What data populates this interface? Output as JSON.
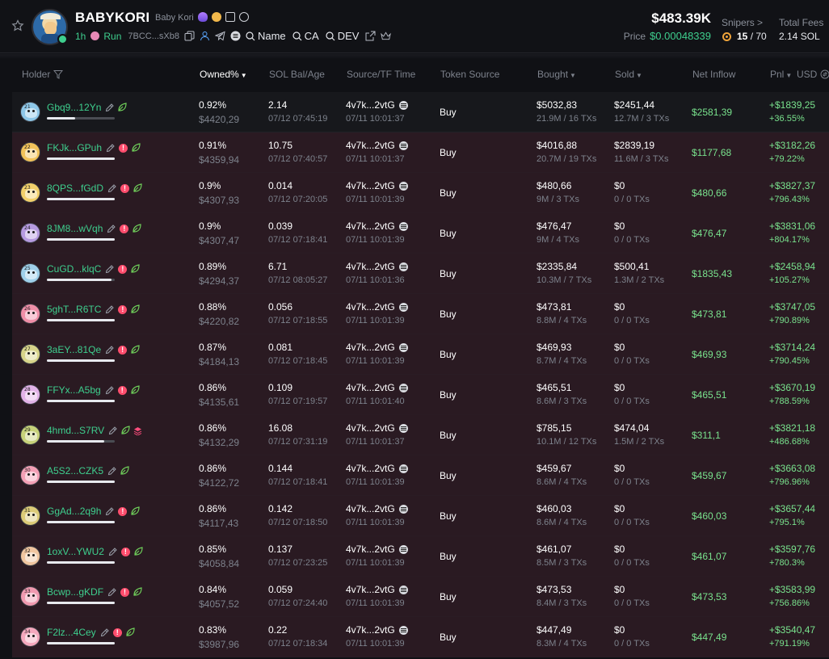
{
  "token": {
    "symbol": "BABYKORI",
    "name": "Baby Kori",
    "age": "1h",
    "platform": "Run",
    "contract": "7BCC...sXb8",
    "search_name": "Name",
    "search_ca": "CA",
    "search_dev": "DEV"
  },
  "stats": {
    "market_cap": "$483.39K",
    "price_label": "Price",
    "price": "$0.00048339",
    "snipers_label": "Snipers >",
    "snipers_value": "15",
    "snipers_total": "/ 70",
    "fees_label": "Total Fees",
    "fees_value": "2.14 SOL"
  },
  "columns": {
    "holder": "Holder",
    "owned": "Owned%",
    "sol_bal": "SOL Bal/Age",
    "source": "Source/TF Time",
    "token_source": "Token Source",
    "bought": "Bought",
    "sold": "Sold",
    "net_inflow": "Net Inflow",
    "pnl": "Pnl",
    "currency": "USD"
  },
  "colors": {
    "accent_green": "#3ecf8e",
    "pnl_green": "#79e28d",
    "warning_red": "#ff4d6d",
    "row_tint": "#2a1a22"
  },
  "holders": [
    {
      "rank": "21",
      "addr": "Gbq9...12Yn",
      "warn": false,
      "extra": false,
      "bar": 0.42,
      "owned": "0.92%",
      "owned_usd": "$4420,29",
      "sol": "2.14",
      "sol_age": "07/12 07:45:19",
      "src": "4v7k...2vtG",
      "src_time": "07/11 10:01:37",
      "token_src": "Buy",
      "bought": "$5032,83",
      "bought_sub": "21.9M / 16 TXs",
      "sold": "$2451,44",
      "sold_sub": "12.7M / 3 TXs",
      "net": "$2581,39",
      "pnl": "+$1839,25",
      "pnl_pct": "+36.55%",
      "av": "#8ec7e8"
    },
    {
      "rank": "22",
      "addr": "FKJk...GPuh",
      "warn": true,
      "extra": false,
      "bar": 1.0,
      "owned": "0.91%",
      "owned_usd": "$4359,94",
      "sol": "10.75",
      "sol_age": "07/12 07:40:57",
      "src": "4v7k...2vtG",
      "src_time": "07/11 10:01:37",
      "token_src": "Buy",
      "bought": "$4016,88",
      "bought_sub": "20.7M / 19 TXs",
      "sold": "$2839,19",
      "sold_sub": "11.6M / 3 TXs",
      "net": "$1177,68",
      "pnl": "+$3182,26",
      "pnl_pct": "+79.22%",
      "av": "#f2c25a"
    },
    {
      "rank": "23",
      "addr": "8QPS...fGdD",
      "warn": true,
      "extra": false,
      "bar": 1.0,
      "owned": "0.9%",
      "owned_usd": "$4307,93",
      "sol": "0.014",
      "sol_age": "07/12 07:20:05",
      "src": "4v7k...2vtG",
      "src_time": "07/11 10:01:39",
      "token_src": "Buy",
      "bought": "$480,66",
      "bought_sub": "9M / 3 TXs",
      "sold": "$0",
      "sold_sub": "0 / 0 TXs",
      "net": "$480,66",
      "pnl": "+$3827,37",
      "pnl_pct": "+796.43%",
      "av": "#f2d06b"
    },
    {
      "rank": "24",
      "addr": "8JM8...wVqh",
      "warn": true,
      "extra": false,
      "bar": 1.0,
      "owned": "0.9%",
      "owned_usd": "$4307,47",
      "sol": "0.039",
      "sol_age": "07/12 07:18:41",
      "src": "4v7k...2vtG",
      "src_time": "07/11 10:01:39",
      "token_src": "Buy",
      "bought": "$476,47",
      "bought_sub": "9M / 4 TXs",
      "sold": "$0",
      "sold_sub": "0 / 0 TXs",
      "net": "$476,47",
      "pnl": "+$3831,06",
      "pnl_pct": "+804.17%",
      "av": "#b69be0"
    },
    {
      "rank": "25",
      "addr": "CuGD...klqC",
      "warn": true,
      "extra": false,
      "bar": 0.95,
      "owned": "0.89%",
      "owned_usd": "$4294,37",
      "sol": "6.71",
      "sol_age": "07/12 08:05:27",
      "src": "4v7k...2vtG",
      "src_time": "07/11 10:01:36",
      "token_src": "Buy",
      "bought": "$2335,84",
      "bought_sub": "10.3M / 7 TXs",
      "sold": "$500,41",
      "sold_sub": "1.3M / 2 TXs",
      "net": "$1835,43",
      "pnl": "+$2458,94",
      "pnl_pct": "+105.27%",
      "av": "#9fd0ea"
    },
    {
      "rank": "26",
      "addr": "5ghT...R6TC",
      "warn": true,
      "extra": false,
      "bar": 1.0,
      "owned": "0.88%",
      "owned_usd": "$4220,82",
      "sol": "0.056",
      "sol_age": "07/12 07:18:55",
      "src": "4v7k...2vtG",
      "src_time": "07/11 10:01:39",
      "token_src": "Buy",
      "bought": "$473,81",
      "bought_sub": "8.8M / 4 TXs",
      "sold": "$0",
      "sold_sub": "0 / 0 TXs",
      "net": "$473,81",
      "pnl": "+$3747,05",
      "pnl_pct": "+790.89%",
      "av": "#ef8fa8"
    },
    {
      "rank": "27",
      "addr": "3aEY...81Qe",
      "warn": true,
      "extra": false,
      "bar": 1.0,
      "owned": "0.87%",
      "owned_usd": "$4184,13",
      "sol": "0.081",
      "sol_age": "07/12 07:18:45",
      "src": "4v7k...2vtG",
      "src_time": "07/11 10:01:39",
      "token_src": "Buy",
      "bought": "$469,93",
      "bought_sub": "8.7M / 4 TXs",
      "sold": "$0",
      "sold_sub": "0 / 0 TXs",
      "net": "$469,93",
      "pnl": "+$3714,24",
      "pnl_pct": "+790.45%",
      "av": "#d7d48a"
    },
    {
      "rank": "28",
      "addr": "FFYx...A5bg",
      "warn": true,
      "extra": false,
      "bar": 1.0,
      "owned": "0.86%",
      "owned_usd": "$4135,61",
      "sol": "0.109",
      "sol_age": "07/12 07:19:57",
      "src": "4v7k...2vtG",
      "src_time": "07/11 10:01:40",
      "token_src": "Buy",
      "bought": "$465,51",
      "bought_sub": "8.6M / 3 TXs",
      "sold": "$0",
      "sold_sub": "0 / 0 TXs",
      "net": "$465,51",
      "pnl": "+$3670,19",
      "pnl_pct": "+788.59%",
      "av": "#e2b3e8"
    },
    {
      "rank": "29",
      "addr": "4hmd...S7RV",
      "warn": false,
      "extra": true,
      "bar": 0.85,
      "owned": "0.86%",
      "owned_usd": "$4132,29",
      "sol": "16.08",
      "sol_age": "07/12 07:31:19",
      "src": "4v7k...2vtG",
      "src_time": "07/11 10:01:37",
      "token_src": "Buy",
      "bought": "$785,15",
      "bought_sub": "10.1M / 12 TXs",
      "sold": "$474,04",
      "sold_sub": "1.5M / 2 TXs",
      "net": "$311,1",
      "pnl": "+$3821,18",
      "pnl_pct": "+486.68%",
      "av": "#c7d27a"
    },
    {
      "rank": "30",
      "addr": "A5S2...CZK5",
      "warn": false,
      "extra": false,
      "bar": 1.0,
      "owned": "0.86%",
      "owned_usd": "$4122,72",
      "sol": "0.144",
      "sol_age": "07/12 07:18:41",
      "src": "4v7k...2vtG",
      "src_time": "07/11 10:01:39",
      "token_src": "Buy",
      "bought": "$459,67",
      "bought_sub": "8.6M / 4 TXs",
      "sold": "$0",
      "sold_sub": "0 / 0 TXs",
      "net": "$459,67",
      "pnl": "+$3663,08",
      "pnl_pct": "+796.96%",
      "av": "#f3a0b6"
    },
    {
      "rank": "31",
      "addr": "GgAd...2q9h",
      "warn": true,
      "extra": false,
      "bar": 1.0,
      "owned": "0.86%",
      "owned_usd": "$4117,43",
      "sol": "0.142",
      "sol_age": "07/12 07:18:50",
      "src": "4v7k...2vtG",
      "src_time": "07/11 10:01:39",
      "token_src": "Buy",
      "bought": "$460,03",
      "bought_sub": "8.6M / 4 TXs",
      "sold": "$0",
      "sold_sub": "0 / 0 TXs",
      "net": "$460,03",
      "pnl": "+$3657,44",
      "pnl_pct": "+795.1%",
      "av": "#dccb78"
    },
    {
      "rank": "32",
      "addr": "1oxV...YWU2",
      "warn": true,
      "extra": false,
      "bar": 1.0,
      "owned": "0.85%",
      "owned_usd": "$4058,84",
      "sol": "0.137",
      "sol_age": "07/12 07:23:25",
      "src": "4v7k...2vtG",
      "src_time": "07/11 10:01:39",
      "token_src": "Buy",
      "bought": "$461,07",
      "bought_sub": "8.5M / 3 TXs",
      "sold": "$0",
      "sold_sub": "0 / 0 TXs",
      "net": "$461,07",
      "pnl": "+$3597,76",
      "pnl_pct": "+780.3%",
      "av": "#f0c6a0"
    },
    {
      "rank": "33",
      "addr": "Bcwp...gKDF",
      "warn": true,
      "extra": false,
      "bar": 1.0,
      "owned": "0.84%",
      "owned_usd": "$4057,52",
      "sol": "0.059",
      "sol_age": "07/12 07:24:40",
      "src": "4v7k...2vtG",
      "src_time": "07/11 10:01:39",
      "token_src": "Buy",
      "bought": "$473,53",
      "bought_sub": "8.4M / 3 TXs",
      "sold": "$0",
      "sold_sub": "0 / 0 TXs",
      "net": "$473,53",
      "pnl": "+$3583,99",
      "pnl_pct": "+756.86%",
      "av": "#f09ab0"
    },
    {
      "rank": "34",
      "addr": "F2lz...4Cey",
      "warn": true,
      "extra": false,
      "bar": 1.0,
      "owned": "0.83%",
      "owned_usd": "$3987,96",
      "sol": "0.22",
      "sol_age": "07/12 07:18:34",
      "src": "4v7k...2vtG",
      "src_time": "07/11 10:01:39",
      "token_src": "Buy",
      "bought": "$447,49",
      "bought_sub": "8.3M / 4 TXs",
      "sold": "$0",
      "sold_sub": "0 / 0 TXs",
      "net": "$447,49",
      "pnl": "+$3540,47",
      "pnl_pct": "+791.19%",
      "av": "#f4a8bd"
    }
  ]
}
